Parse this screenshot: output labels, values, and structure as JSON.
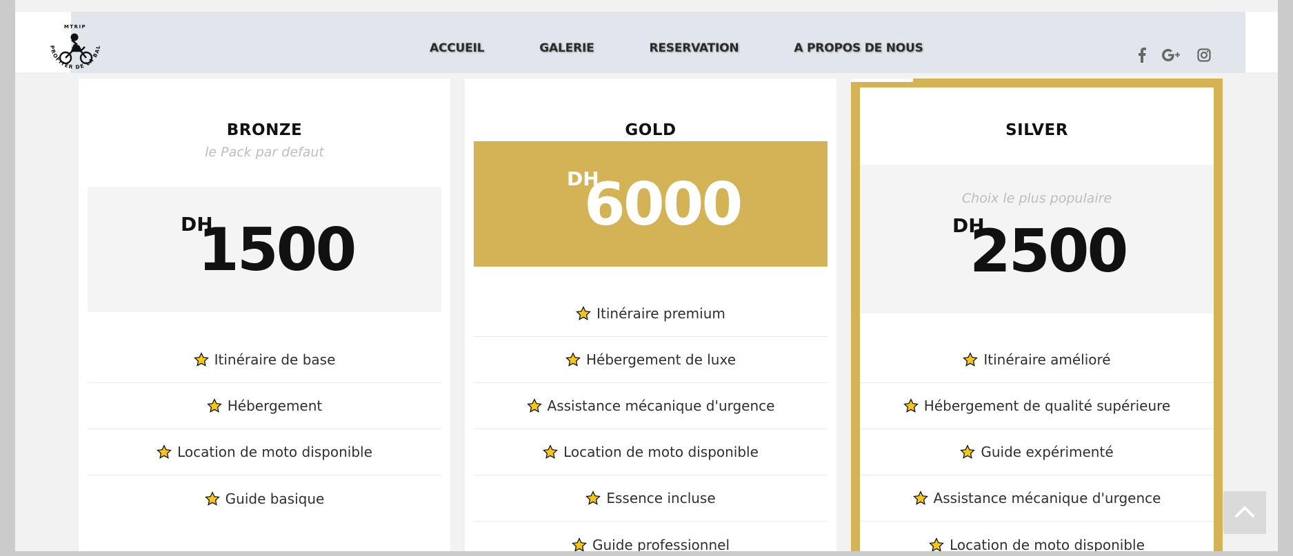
{
  "logo": {
    "top_text": "MTRIP",
    "ring_text": "PROFITER DE LA BALADE"
  },
  "nav": {
    "items": [
      "ACCUEIL",
      "GALERIE",
      "RESERVATION",
      "A PROPOS DE NOUS"
    ]
  },
  "social": [
    "facebook-icon",
    "google-plus-icon",
    "instagram-icon"
  ],
  "colors": {
    "accent": "#d3b356",
    "navbar": "#e1e6ed",
    "star": "#f5c518"
  },
  "plans": {
    "bronze": {
      "name": "BRONZE",
      "subtitle": "le Pack par defaut",
      "currency": "DH",
      "price": "1500",
      "features": [
        "Itinéraire de base",
        "Hébergement",
        "Location de moto disponible",
        "Guide basique"
      ]
    },
    "gold": {
      "name": "GOLD",
      "currency": "DH",
      "price": "6000",
      "features": [
        "Itinéraire premium",
        "Hébergement de luxe",
        "Assistance mécanique d'urgence",
        "Location de moto disponible",
        "Essence incluse",
        "Guide professionnel"
      ]
    },
    "silver": {
      "name": "SILVER",
      "subtitle": "Choix le plus populaire",
      "currency": "DH",
      "price": "2500",
      "features": [
        "Itinéraire amélioré",
        "Hébergement de qualité supérieure",
        "Guide expérimenté",
        "Assistance mécanique d'urgence",
        "Location de moto disponible"
      ]
    }
  }
}
